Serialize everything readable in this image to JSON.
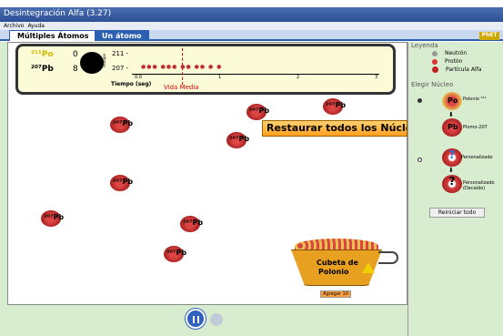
{
  "window": {
    "title": "Desintegración Alfa (3.27)"
  },
  "menu": {
    "items": [
      "Archivo",
      "Ayuda"
    ]
  },
  "tabs": {
    "tab1": "Múltiples Átomos",
    "tab2": "Un átomo",
    "logo": "PhET"
  },
  "counter": {
    "po_label": "²¹¹Po",
    "po_count": "0",
    "pb_label": "²⁰⁷Pb",
    "pb_count": "8",
    "axis_label_211": "211 -",
    "axis_label_207": "207 -",
    "y_caption": "Isótopo",
    "time_label": "Tiempo (seg)",
    "half_life": "Vida Media",
    "ticks": [
      "0.0",
      "1",
      "2",
      "3"
    ]
  },
  "reset_button": "Restaurar todos los Núcleos",
  "atoms": {
    "label": "²⁰⁷Pb"
  },
  "bucket": {
    "title_line1": "Cubeta de",
    "title_line2": "Polonio",
    "add_button": "Agregar 10"
  },
  "legend": {
    "title": "Leyenda",
    "items": [
      {
        "label": "Neutrón",
        "color": "#999999"
      },
      {
        "label": "Protón",
        "color": "#e03030"
      },
      {
        "label": "Partícula Alfa",
        "color": "#c02020"
      }
    ]
  },
  "nucleus": {
    "title": "Elegir Núcleo",
    "opt1_label": "Polonio ²¹¹",
    "opt1_symbol": "Po",
    "opt1_result": "Plomo-207",
    "opt1_result_symbol": "Pb",
    "opt2_label": "Personalizado",
    "opt2_result": "Personalizado (Decaído)"
  },
  "reset_all": "Reiniciar todo",
  "colors": {
    "accent": "#2d5fb0",
    "panel": "#d8ecd0",
    "reset": "#ffa020"
  }
}
